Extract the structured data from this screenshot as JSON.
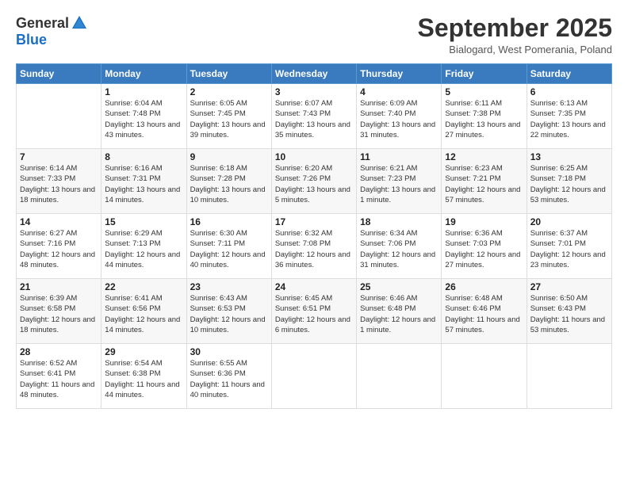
{
  "header": {
    "logo": {
      "general": "General",
      "blue": "Blue"
    },
    "title": "September 2025",
    "location": "Bialogard, West Pomerania, Poland"
  },
  "weekdays": [
    "Sunday",
    "Monday",
    "Tuesday",
    "Wednesday",
    "Thursday",
    "Friday",
    "Saturday"
  ],
  "weeks": [
    [
      {
        "day": "",
        "sunrise": "",
        "sunset": "",
        "daylight": ""
      },
      {
        "day": "1",
        "sunrise": "Sunrise: 6:04 AM",
        "sunset": "Sunset: 7:48 PM",
        "daylight": "Daylight: 13 hours and 43 minutes."
      },
      {
        "day": "2",
        "sunrise": "Sunrise: 6:05 AM",
        "sunset": "Sunset: 7:45 PM",
        "daylight": "Daylight: 13 hours and 39 minutes."
      },
      {
        "day": "3",
        "sunrise": "Sunrise: 6:07 AM",
        "sunset": "Sunset: 7:43 PM",
        "daylight": "Daylight: 13 hours and 35 minutes."
      },
      {
        "day": "4",
        "sunrise": "Sunrise: 6:09 AM",
        "sunset": "Sunset: 7:40 PM",
        "daylight": "Daylight: 13 hours and 31 minutes."
      },
      {
        "day": "5",
        "sunrise": "Sunrise: 6:11 AM",
        "sunset": "Sunset: 7:38 PM",
        "daylight": "Daylight: 13 hours and 27 minutes."
      },
      {
        "day": "6",
        "sunrise": "Sunrise: 6:13 AM",
        "sunset": "Sunset: 7:35 PM",
        "daylight": "Daylight: 13 hours and 22 minutes."
      }
    ],
    [
      {
        "day": "7",
        "sunrise": "Sunrise: 6:14 AM",
        "sunset": "Sunset: 7:33 PM",
        "daylight": "Daylight: 13 hours and 18 minutes."
      },
      {
        "day": "8",
        "sunrise": "Sunrise: 6:16 AM",
        "sunset": "Sunset: 7:31 PM",
        "daylight": "Daylight: 13 hours and 14 minutes."
      },
      {
        "day": "9",
        "sunrise": "Sunrise: 6:18 AM",
        "sunset": "Sunset: 7:28 PM",
        "daylight": "Daylight: 13 hours and 10 minutes."
      },
      {
        "day": "10",
        "sunrise": "Sunrise: 6:20 AM",
        "sunset": "Sunset: 7:26 PM",
        "daylight": "Daylight: 13 hours and 5 minutes."
      },
      {
        "day": "11",
        "sunrise": "Sunrise: 6:21 AM",
        "sunset": "Sunset: 7:23 PM",
        "daylight": "Daylight: 13 hours and 1 minute."
      },
      {
        "day": "12",
        "sunrise": "Sunrise: 6:23 AM",
        "sunset": "Sunset: 7:21 PM",
        "daylight": "Daylight: 12 hours and 57 minutes."
      },
      {
        "day": "13",
        "sunrise": "Sunrise: 6:25 AM",
        "sunset": "Sunset: 7:18 PM",
        "daylight": "Daylight: 12 hours and 53 minutes."
      }
    ],
    [
      {
        "day": "14",
        "sunrise": "Sunrise: 6:27 AM",
        "sunset": "Sunset: 7:16 PM",
        "daylight": "Daylight: 12 hours and 48 minutes."
      },
      {
        "day": "15",
        "sunrise": "Sunrise: 6:29 AM",
        "sunset": "Sunset: 7:13 PM",
        "daylight": "Daylight: 12 hours and 44 minutes."
      },
      {
        "day": "16",
        "sunrise": "Sunrise: 6:30 AM",
        "sunset": "Sunset: 7:11 PM",
        "daylight": "Daylight: 12 hours and 40 minutes."
      },
      {
        "day": "17",
        "sunrise": "Sunrise: 6:32 AM",
        "sunset": "Sunset: 7:08 PM",
        "daylight": "Daylight: 12 hours and 36 minutes."
      },
      {
        "day": "18",
        "sunrise": "Sunrise: 6:34 AM",
        "sunset": "Sunset: 7:06 PM",
        "daylight": "Daylight: 12 hours and 31 minutes."
      },
      {
        "day": "19",
        "sunrise": "Sunrise: 6:36 AM",
        "sunset": "Sunset: 7:03 PM",
        "daylight": "Daylight: 12 hours and 27 minutes."
      },
      {
        "day": "20",
        "sunrise": "Sunrise: 6:37 AM",
        "sunset": "Sunset: 7:01 PM",
        "daylight": "Daylight: 12 hours and 23 minutes."
      }
    ],
    [
      {
        "day": "21",
        "sunrise": "Sunrise: 6:39 AM",
        "sunset": "Sunset: 6:58 PM",
        "daylight": "Daylight: 12 hours and 18 minutes."
      },
      {
        "day": "22",
        "sunrise": "Sunrise: 6:41 AM",
        "sunset": "Sunset: 6:56 PM",
        "daylight": "Daylight: 12 hours and 14 minutes."
      },
      {
        "day": "23",
        "sunrise": "Sunrise: 6:43 AM",
        "sunset": "Sunset: 6:53 PM",
        "daylight": "Daylight: 12 hours and 10 minutes."
      },
      {
        "day": "24",
        "sunrise": "Sunrise: 6:45 AM",
        "sunset": "Sunset: 6:51 PM",
        "daylight": "Daylight: 12 hours and 6 minutes."
      },
      {
        "day": "25",
        "sunrise": "Sunrise: 6:46 AM",
        "sunset": "Sunset: 6:48 PM",
        "daylight": "Daylight: 12 hours and 1 minute."
      },
      {
        "day": "26",
        "sunrise": "Sunrise: 6:48 AM",
        "sunset": "Sunset: 6:46 PM",
        "daylight": "Daylight: 11 hours and 57 minutes."
      },
      {
        "day": "27",
        "sunrise": "Sunrise: 6:50 AM",
        "sunset": "Sunset: 6:43 PM",
        "daylight": "Daylight: 11 hours and 53 minutes."
      }
    ],
    [
      {
        "day": "28",
        "sunrise": "Sunrise: 6:52 AM",
        "sunset": "Sunset: 6:41 PM",
        "daylight": "Daylight: 11 hours and 48 minutes."
      },
      {
        "day": "29",
        "sunrise": "Sunrise: 6:54 AM",
        "sunset": "Sunset: 6:38 PM",
        "daylight": "Daylight: 11 hours and 44 minutes."
      },
      {
        "day": "30",
        "sunrise": "Sunrise: 6:55 AM",
        "sunset": "Sunset: 6:36 PM",
        "daylight": "Daylight: 11 hours and 40 minutes."
      },
      {
        "day": "",
        "sunrise": "",
        "sunset": "",
        "daylight": ""
      },
      {
        "day": "",
        "sunrise": "",
        "sunset": "",
        "daylight": ""
      },
      {
        "day": "",
        "sunrise": "",
        "sunset": "",
        "daylight": ""
      },
      {
        "day": "",
        "sunrise": "",
        "sunset": "",
        "daylight": ""
      }
    ]
  ]
}
